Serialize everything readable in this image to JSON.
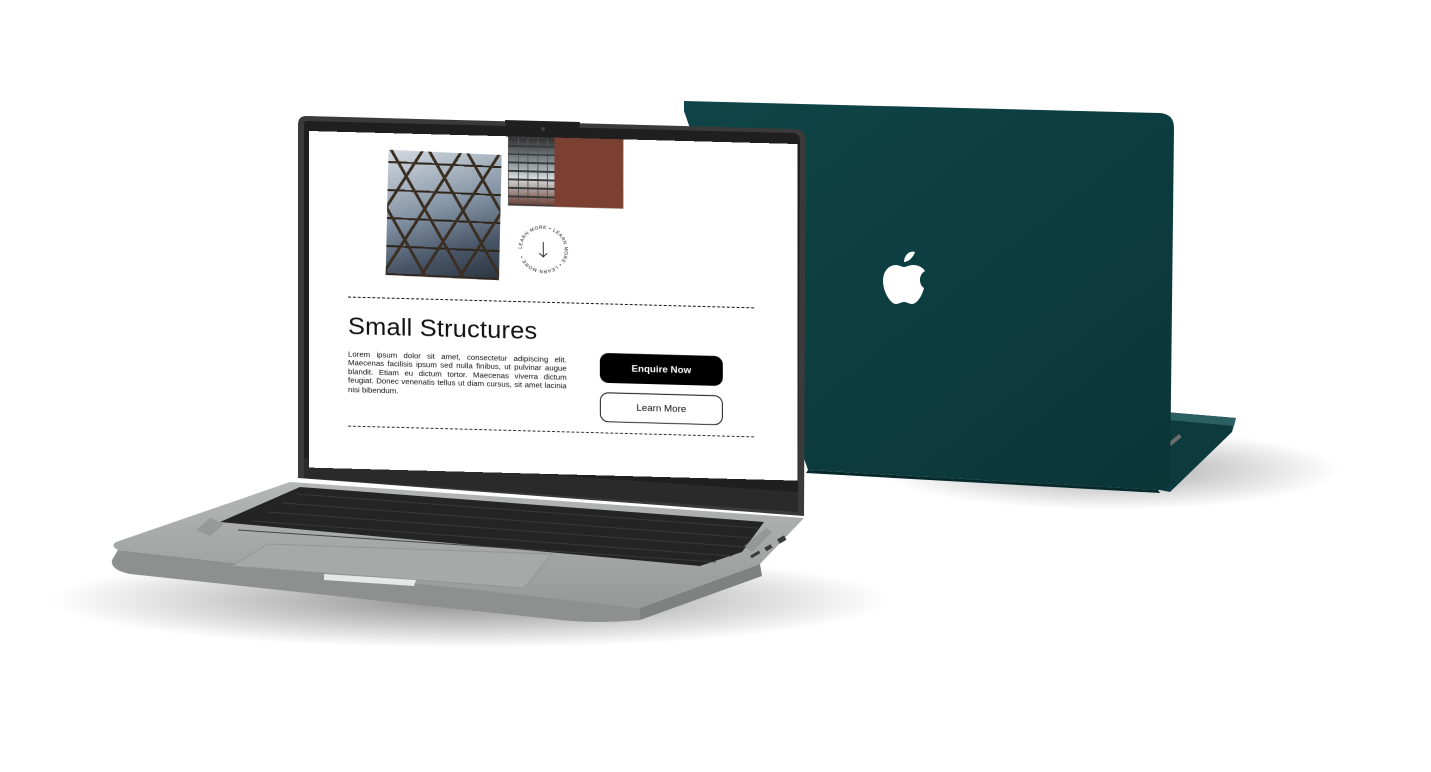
{
  "page": {
    "title": "Small Structures",
    "body": "Lorem ipsum dolor sit amet, consectetur adipiscing elit. Maecenas facilisis ipsum sed nulla finibus, ut pulvinar augue blandit. Etiam eu dictum tortor. Maecenas viverra dictum feugiat. Donec venenatis tellus ut diam cursus, sit amet lacinia nisi bibendum.",
    "badge_text": "LEARN MORE • LEARN MORE • LEARN MORE •",
    "buttons": {
      "primary": "Enquire Now",
      "secondary": "Learn More"
    }
  },
  "colors": {
    "back_laptop_lid": "#0c3f42",
    "front_laptop_body": "#a3a5a4",
    "bezel": "#1f1f1f",
    "keyboard": "#242424",
    "primary_button": "#000000"
  },
  "icons": {
    "badge_arrow": "arrow-down-icon",
    "logo": "apple-logo-icon"
  }
}
